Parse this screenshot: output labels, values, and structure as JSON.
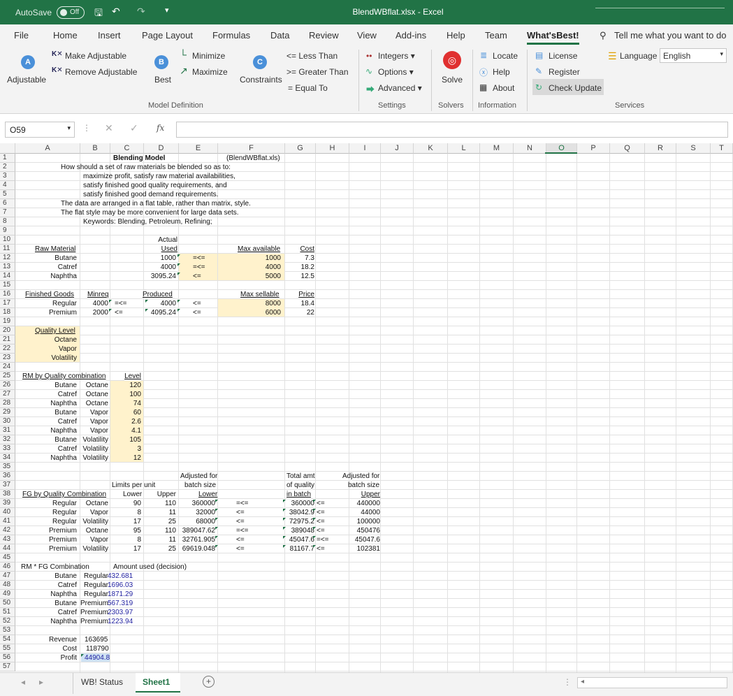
{
  "app": {
    "autosave_label": "AutoSave",
    "autosave_state": "Off",
    "title": "BlendWBflat.xlsx - Excel",
    "accent": "#217346"
  },
  "tabs": [
    "File",
    "Home",
    "Insert",
    "Page Layout",
    "Formulas",
    "Data",
    "Review",
    "View",
    "Add-ins",
    "Help",
    "Team",
    "What'sBest!"
  ],
  "tell_me": "Tell me what you want to do",
  "ribbon": {
    "adjustable": "Adjustable",
    "make_adjustable": "Make Adjustable",
    "remove_adjustable": "Remove Adjustable",
    "best": "Best",
    "minimize": "Minimize",
    "maximize": "Maximize",
    "constraints": "Constraints",
    "less_than": "<= Less Than",
    "greater_than": ">= Greater Than",
    "equal_to": "= Equal To",
    "integers": "Integers",
    "options": "Options",
    "advanced": "Advanced",
    "solve": "Solve",
    "locate": "Locate",
    "help": "Help",
    "about": "About",
    "license": "License",
    "register": "Register",
    "check_update": "Check Update",
    "language_label": "Language",
    "language_value": "English",
    "groups": {
      "model_definition": "Model Definition",
      "settings": "Settings",
      "solvers": "Solvers",
      "information": "Information",
      "services": "Services"
    }
  },
  "formula_bar": {
    "name_box": "O59",
    "fx": "fx",
    "value": ""
  },
  "columns": [
    "A",
    "B",
    "C",
    "D",
    "E",
    "F",
    "G",
    "H",
    "I",
    "J",
    "K",
    "L",
    "M",
    "N",
    "O",
    "P",
    "Q",
    "R",
    "S",
    "T"
  ],
  "rows": [
    "1",
    "2",
    "3",
    "4",
    "5",
    "6",
    "7",
    "8",
    "9",
    "10",
    "11",
    "12",
    "13",
    "14",
    "15",
    "16",
    "17",
    "18",
    "19",
    "20",
    "21",
    "22",
    "23",
    "24",
    "25",
    "26",
    "27",
    "28",
    "29",
    "30",
    "31",
    "32",
    "33",
    "34",
    "35",
    "36",
    "37",
    "38",
    "39",
    "40",
    "41",
    "42",
    "43",
    "44",
    "45",
    "46",
    "47",
    "48",
    "49",
    "50",
    "51",
    "52",
    "53",
    "54",
    "55",
    "56",
    "57"
  ],
  "cells": {
    "title": "Blending Model",
    "fname": "(BlendWBflat.xls)",
    "d2": "How should a set of raw materials be blended so as to:",
    "d3": "maximize profit, satisfy raw material availabilities,",
    "d4": "satisfy finished good quality requirements, and",
    "d5": "satisfy finished good demand requirements.",
    "d6": "The data are arranged in a flat table, rather than matrix, style.",
    "d7": "The flat style may be more convenient for large data sets.",
    "d8": "Keywords: Blending, Petroleum, Refining;",
    "actual": "Actual",
    "used": "Used",
    "raw_material": "Raw Material",
    "rm": [
      "Butane",
      "Catref",
      "Naphtha"
    ],
    "used_vals": [
      "1000",
      "4000",
      "3095.24"
    ],
    "rm_ops": [
      "=<=",
      "=<=",
      "<="
    ],
    "max_available": "Max available",
    "max_av_vals": [
      "1000",
      "4000",
      "5000"
    ],
    "cost": "Cost",
    "cost_vals": [
      "7.3",
      "18.2",
      "12.5"
    ],
    "finished_goods": "Finished Goods",
    "minreq": "Minreq",
    "produced": "Produced",
    "max_sellable": "Max sellable",
    "price": "Price",
    "fg": [
      "Regular",
      "Premium"
    ],
    "minreq_vals": [
      "4000",
      "2000"
    ],
    "fg_ops1": [
      "=<=",
      "<="
    ],
    "produced_vals": [
      "4000",
      "4095.24"
    ],
    "fg_ops2": [
      "<=",
      "<="
    ],
    "max_sell_vals": [
      "8000",
      "6000"
    ],
    "price_vals": [
      "18.4",
      "22"
    ],
    "quality_level": "Quality Level",
    "ql": [
      "Octane",
      "Vapor",
      "Volatility"
    ],
    "rm_by_q": "RM by Quality combination",
    "level": "Level",
    "rq_rm": [
      "Butane",
      "Catref",
      "Naphtha",
      "Butane",
      "Catref",
      "Naphtha",
      "Butane",
      "Catref",
      "Naphtha"
    ],
    "rq_q": [
      "Octane",
      "Octane",
      "Octane",
      "Vapor",
      "Vapor",
      "Vapor",
      "Volatility",
      "Volatility",
      "Volatility"
    ],
    "rq_lvl": [
      "120",
      "100",
      "74",
      "60",
      "2.6",
      "4.1",
      "105",
      "3",
      "12"
    ],
    "adj_batch1": "Adjusted for",
    "adj_batch2": "batch size",
    "limits": "Limits per unit",
    "lower": "Lower",
    "upper": "Upper",
    "total1": "Total amt",
    "total2": "of quality",
    "total3": "in batch",
    "adj_upper1": "Adjusted for",
    "adj_upper2": "batch size",
    "upper2": "Upper",
    "fg_by_q": "FG by Quality Combination",
    "fq_fg": [
      "Regular",
      "Regular",
      "Regular",
      "Premium",
      "Premium",
      "Premium"
    ],
    "fq_q": [
      "Octane",
      "Vapor",
      "Volatility",
      "Octane",
      "Vapor",
      "Volatility"
    ],
    "fq_lo": [
      "90",
      "8",
      "17",
      "95",
      "8",
      "17"
    ],
    "fq_up": [
      "110",
      "11",
      "25",
      "110",
      "11",
      "25"
    ],
    "fq_adjlo": [
      "360000",
      "32000",
      "68000",
      "389047.62",
      "32761.905",
      "69619.048"
    ],
    "fq_op1": [
      "=<=",
      "<=",
      "<=",
      "=<=",
      "<=",
      "<="
    ],
    "fq_tot": [
      "360000",
      "38042.9",
      "72975.2",
      "389048",
      "45047.6",
      "81167.7"
    ],
    "fq_op2": [
      "<=",
      "<=",
      "<=",
      "<=",
      "=<=",
      "<="
    ],
    "fq_adjup": [
      "440000",
      "44000",
      "100000",
      "450476",
      "45047.6",
      "102381"
    ],
    "rm_fg": "RM * FG Combination",
    "amount_used": "Amount used (decision)",
    "rf_rm": [
      "Butane",
      "Catref",
      "Naphtha",
      "Butane",
      "Catref",
      "Naphtha"
    ],
    "rf_fg": [
      "Regular",
      "Regular",
      "Regular",
      "Premium",
      "Premium",
      "Premium"
    ],
    "rf_amt": [
      "432.681",
      "1696.03",
      "1871.29",
      "567.319",
      "2303.97",
      "1223.94"
    ],
    "revenue": "Revenue",
    "revenue_val": "163695",
    "cost_lbl": "Cost",
    "cost_val": "118790",
    "profit": "Profit",
    "profit_val": "44904.8"
  },
  "sheets": [
    "WB! Status",
    "Sheet1"
  ],
  "active_sheet": "Sheet1"
}
